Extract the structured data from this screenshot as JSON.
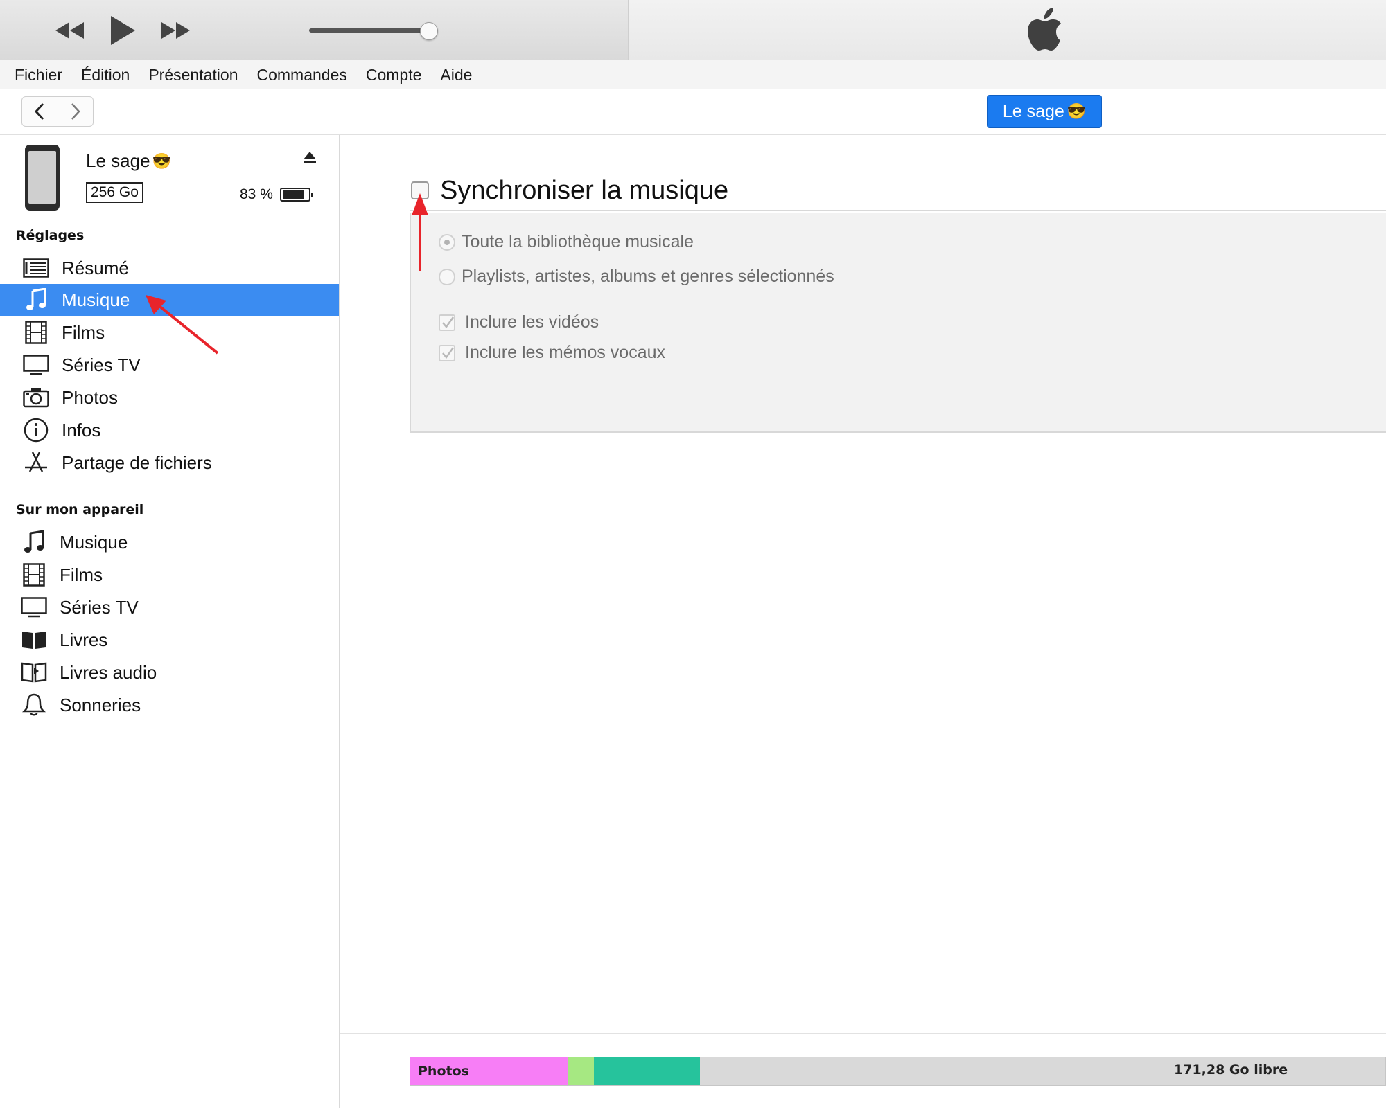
{
  "menu": {
    "items": [
      "Fichier",
      "Édition",
      "Présentation",
      "Commandes",
      "Compte",
      "Aide"
    ]
  },
  "player": {
    "volume_level": 0.93
  },
  "nav": {
    "device_button": "Le sage",
    "device_emoji": "😎"
  },
  "device": {
    "name": "Le sage",
    "emoji": "😎",
    "capacity": "256 Go",
    "battery": "83 %",
    "battery_level": 0.83
  },
  "sidebar": {
    "settings_heading": "Réglages",
    "settings_items": [
      {
        "label": "Résumé",
        "icon": "summary-icon"
      },
      {
        "label": "Musique",
        "icon": "music-note-icon",
        "selected": true
      },
      {
        "label": "Films",
        "icon": "film-icon"
      },
      {
        "label": "Séries TV",
        "icon": "tv-icon"
      },
      {
        "label": "Photos",
        "icon": "camera-icon"
      },
      {
        "label": "Infos",
        "icon": "info-icon"
      },
      {
        "label": "Partage de fichiers",
        "icon": "app-store-icon"
      }
    ],
    "device_heading": "Sur mon appareil",
    "device_items": [
      {
        "label": "Musique",
        "icon": "music-note-icon"
      },
      {
        "label": "Films",
        "icon": "film-icon"
      },
      {
        "label": "Séries TV",
        "icon": "tv-icon"
      },
      {
        "label": "Livres",
        "icon": "book-icon"
      },
      {
        "label": "Livres audio",
        "icon": "audiobook-icon"
      },
      {
        "label": "Sonneries",
        "icon": "bell-icon"
      }
    ]
  },
  "sync": {
    "title": "Synchroniser la musique",
    "checked": false,
    "options": {
      "entire_library": "Toute la bibliothèque musicale",
      "selected": "Playlists, artistes, albums et genres sélectionnés",
      "include_videos": "Inclure les vidéos",
      "include_voice_memos": "Inclure les mémos vocaux"
    }
  },
  "capacity_bar": {
    "segments": [
      {
        "label": "Photos",
        "color": "#f77ef6",
        "fraction": 0.161
      },
      {
        "label": "",
        "color": "#a6e882",
        "fraction": 0.027
      },
      {
        "label": "",
        "color": "#26c39c",
        "fraction": 0.109
      }
    ],
    "free_label": "171,28 Go libre",
    "free_color": "#d9d9d9"
  },
  "colors": {
    "accent": "#3b8cf1",
    "device_button": "#1b7bf0",
    "annotation_arrow": "#e8242b"
  }
}
